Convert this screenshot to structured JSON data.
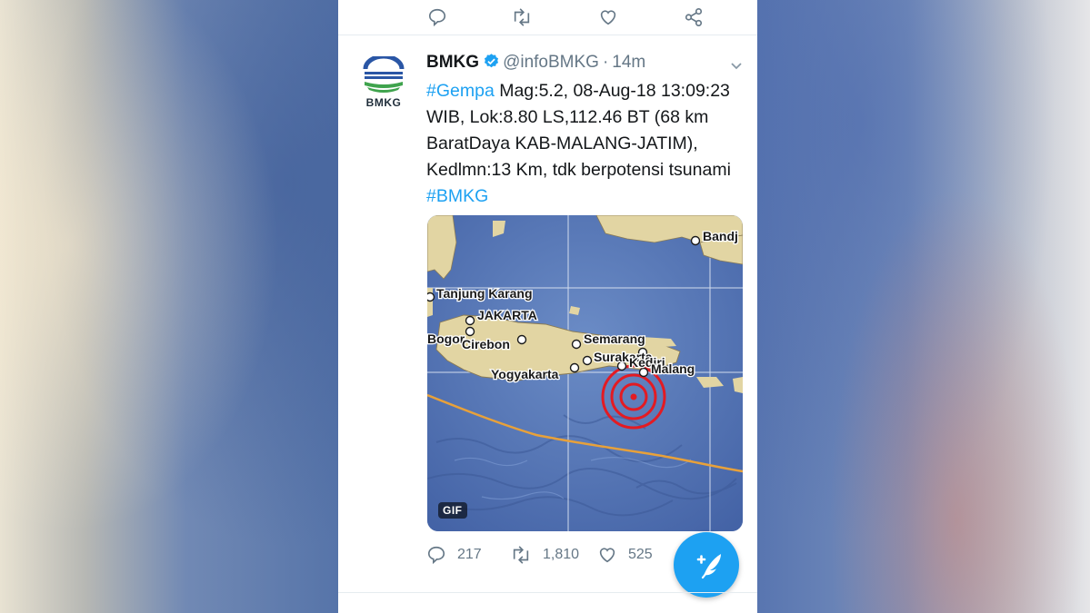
{
  "prev_tweet": {
    "actions": [
      "reply-icon",
      "retweet-icon",
      "like-icon",
      "share-icon"
    ]
  },
  "tweet": {
    "avatar_label": "BMKG",
    "author_name": "BMKG",
    "handle": "@infoBMKG",
    "separator": "·",
    "time": "14m",
    "text_parts": {
      "hashtag1": "#Gempa",
      "body": " Mag:5.2, 08-Aug-18 13:09:23 WIB, Lok:8.80 LS,112.46 BT (68 km BaratDaya KAB-MALANG-JATIM), Kedlmn:13 Km, tdk berpotensi tsunami ",
      "hashtag2": "#BMKG"
    },
    "media": {
      "badge": "GIF",
      "map_labels": {
        "bandung_cut": "Bandj",
        "tanjung_karang": "Tanjung Karang",
        "jakarta": "JAKARTA",
        "bogor": "Bogor",
        "cirebon": "Cirebon",
        "semarang": "Semarang",
        "surakarta": "Surakarta",
        "kediri": "Kediri",
        "malang": "Malang",
        "yogyakarta": "Yogyakarta"
      }
    },
    "stats": {
      "replies": "217",
      "retweets": "1,810",
      "likes": "525"
    }
  },
  "colors": {
    "accent": "#1da1f2",
    "epicenter": "#e31b23",
    "fault_line": "#e8a13a"
  }
}
